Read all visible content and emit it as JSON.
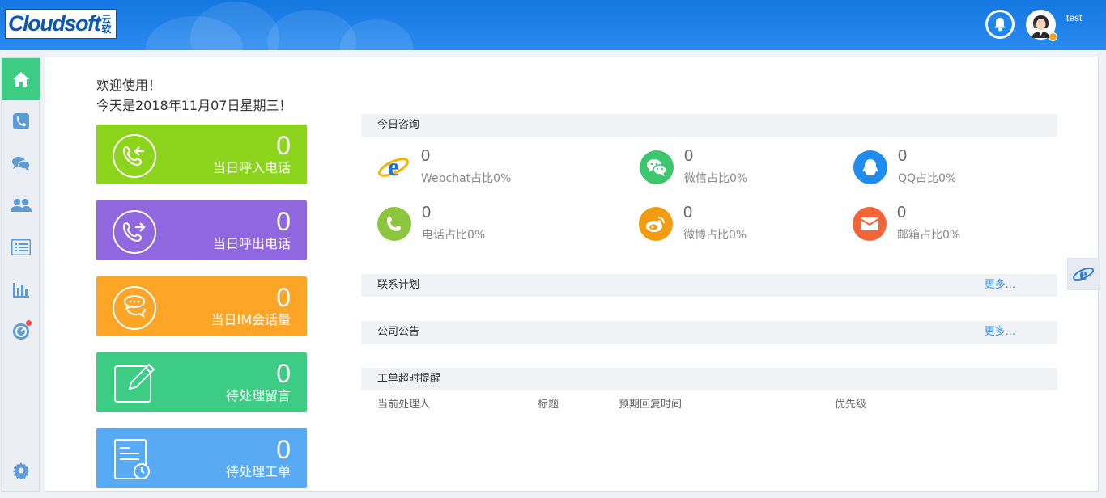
{
  "header": {
    "logo_text": "Cloudsoft",
    "logo_cn": "云软",
    "username": "test"
  },
  "sidebar": {
    "items": [
      {
        "icon": "home-icon",
        "active": true
      },
      {
        "icon": "phone-icon"
      },
      {
        "icon": "chat-icon"
      },
      {
        "icon": "contacts-icon"
      },
      {
        "icon": "list-icon"
      },
      {
        "icon": "bar-chart-icon"
      },
      {
        "icon": "monitor-icon",
        "badge": true
      },
      {
        "icon": "gear-icon"
      }
    ]
  },
  "welcome": {
    "line1": "欢迎使用！",
    "line2": "今天是2018年11月07日星期三！"
  },
  "cards": [
    {
      "value": "0",
      "label": "当日呼入电话",
      "color": "#8cd51c"
    },
    {
      "value": "0",
      "label": "当日呼出电话",
      "color": "#9067de"
    },
    {
      "value": "0",
      "label": "当日IM会话量",
      "color": "#fca526"
    },
    {
      "value": "0",
      "label": "待处理留言",
      "color": "#3ccc83"
    },
    {
      "value": "0",
      "label": "待处理工单",
      "color": "#58aaf5"
    }
  ],
  "consult": {
    "title": "今日咨询",
    "items": [
      {
        "value": "0",
        "label": "Webchat占比0%",
        "icon": "ie-icon"
      },
      {
        "value": "0",
        "label": "微信占比0%",
        "icon": "wechat-icon",
        "color": "#3cc66e"
      },
      {
        "value": "0",
        "label": "QQ占比0%",
        "icon": "qq-icon",
        "color": "#1f8cf0"
      },
      {
        "value": "0",
        "label": "电话占比0%",
        "icon": "phone-icon",
        "color": "#8cc63f"
      },
      {
        "value": "0",
        "label": "微博占比0%",
        "icon": "weibo-icon",
        "color": "#f39c12"
      },
      {
        "value": "0",
        "label": "邮箱占比0%",
        "icon": "mail-icon",
        "color": "#f56436"
      }
    ]
  },
  "contact_plan": {
    "title": "联系计划",
    "more": "更多..."
  },
  "announcement": {
    "title": "公司公告",
    "more": "更多..."
  },
  "ticket_reminder": {
    "title": "工单超时提醒",
    "columns": [
      "当前处理人",
      "标题",
      "预期回复时间",
      "优先级"
    ]
  }
}
